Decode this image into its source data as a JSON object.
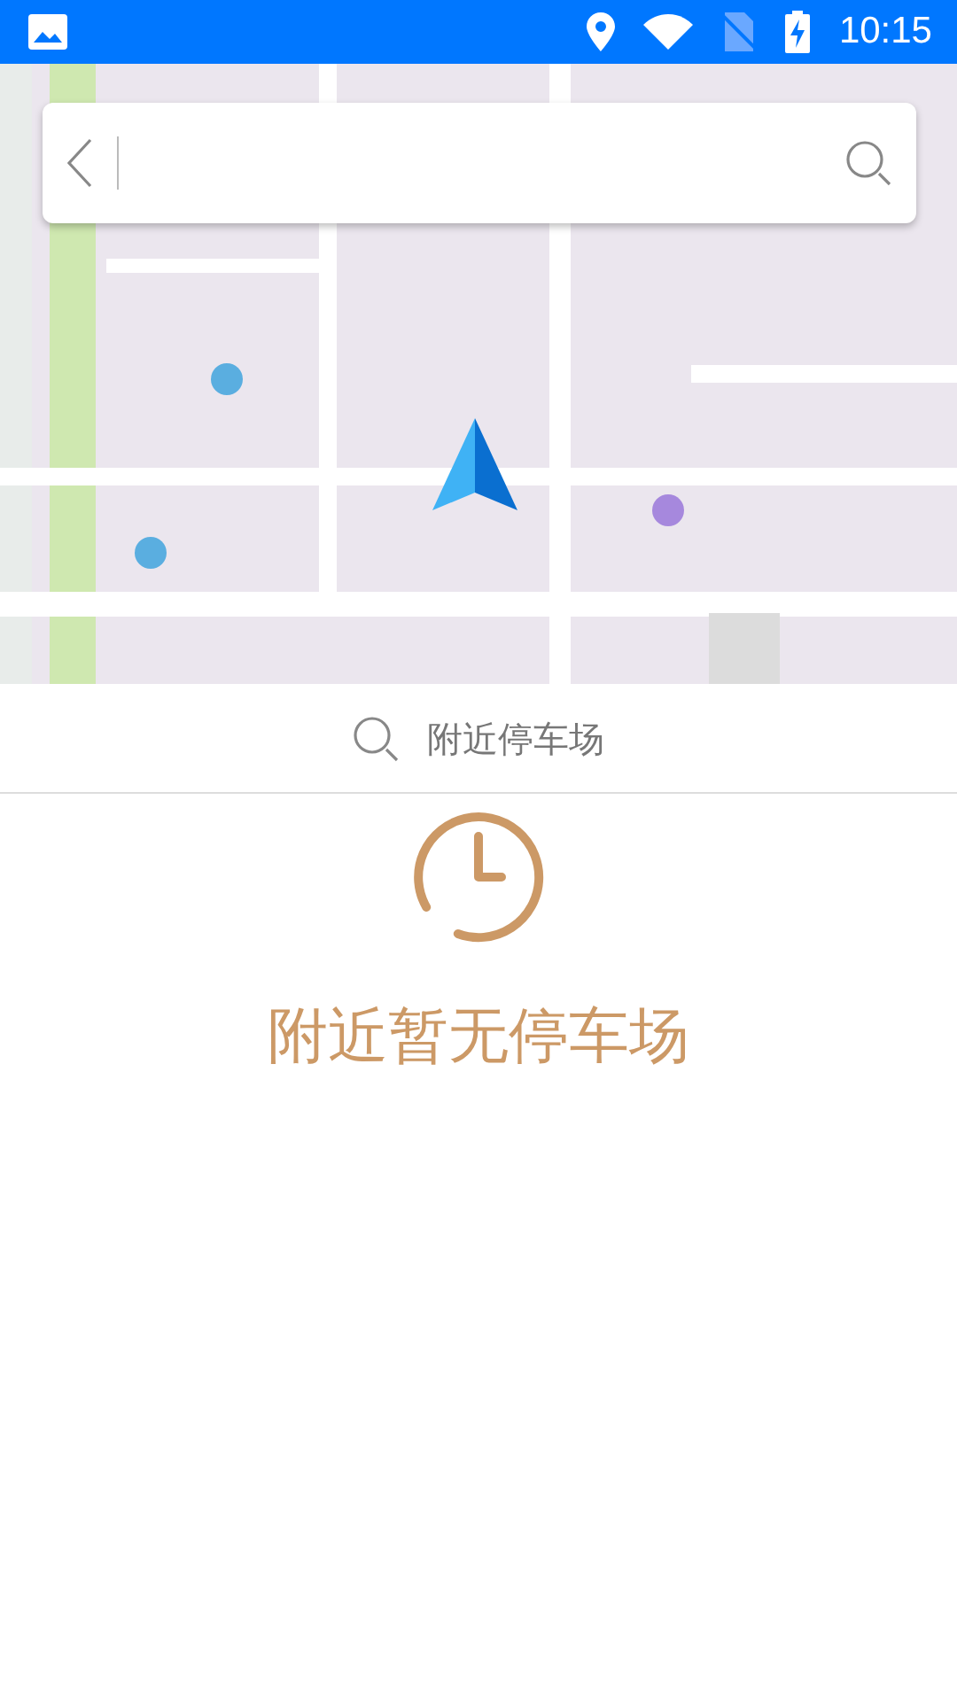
{
  "status_bar": {
    "time": "10:15"
  },
  "nearby_search": {
    "label": "附近停车场"
  },
  "empty_state": {
    "message": "附近暂无停车场"
  }
}
